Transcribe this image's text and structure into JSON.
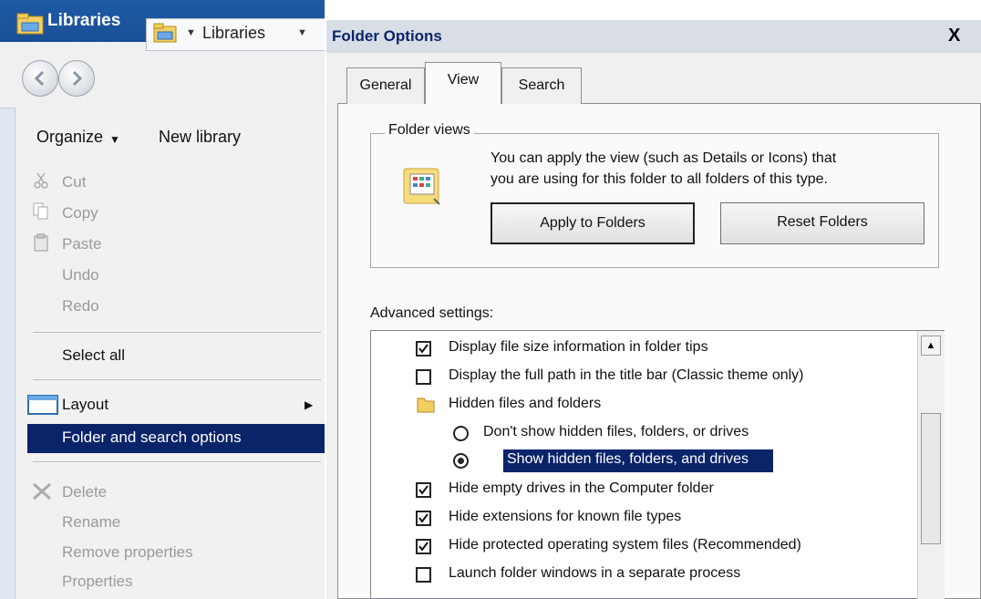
{
  "explorer": {
    "title": "Libraries",
    "address": "Libraries",
    "toolbar": {
      "organize": "Organize",
      "new_library": "New library"
    },
    "menu": {
      "cut": "Cut",
      "copy": "Copy",
      "paste": "Paste",
      "undo": "Undo",
      "redo": "Redo",
      "select_all": "Select all",
      "layout": "Layout",
      "folder_search_options": "Folder and search options",
      "delete": "Delete",
      "rename": "Rename",
      "remove_properties": "Remove properties",
      "properties": "Properties"
    }
  },
  "dialog": {
    "title": "Folder Options",
    "close": "X",
    "tabs": {
      "general": "General",
      "view": "View",
      "search": "Search"
    },
    "folder_views": {
      "legend": "Folder views",
      "desc_line1": "You can apply the view (such as Details or Icons) that",
      "desc_line2": "you are using for this folder to all folders of this type.",
      "apply_button": "Apply to Folders",
      "reset_button": "Reset Folders"
    },
    "advanced_label": "Advanced settings:",
    "advanced": [
      {
        "type": "checkbox",
        "checked": true,
        "label": "Display file size information in folder tips"
      },
      {
        "type": "checkbox",
        "checked": false,
        "label": "Display the full path in the title bar (Classic theme only)"
      },
      {
        "type": "folder",
        "label": "Hidden files and folders"
      },
      {
        "type": "radio",
        "checked": false,
        "label": "Don't show hidden files, folders, or drives"
      },
      {
        "type": "radio",
        "checked": true,
        "label": "Show hidden files, folders, and drives"
      },
      {
        "type": "checkbox",
        "checked": true,
        "label": "Hide empty drives in the Computer folder"
      },
      {
        "type": "checkbox",
        "checked": true,
        "label": "Hide extensions for known file types"
      },
      {
        "type": "checkbox",
        "checked": true,
        "label": "Hide protected operating system files (Recommended)"
      },
      {
        "type": "checkbox",
        "checked": false,
        "label": "Launch folder windows in a separate process"
      }
    ]
  },
  "colors": {
    "selection": "#0a246a",
    "title_bar": "#1e5aa6",
    "panel": "#f0f0f0"
  }
}
